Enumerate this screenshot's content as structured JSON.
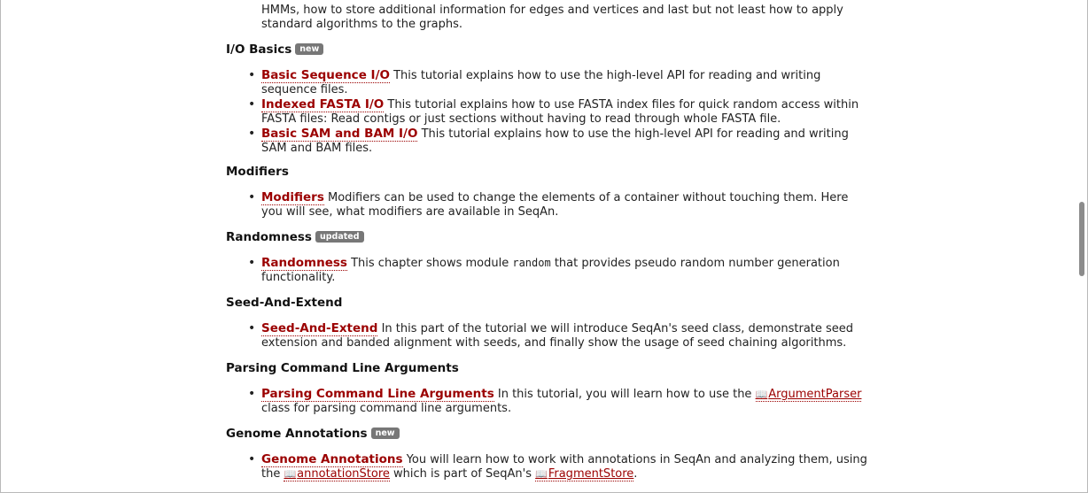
{
  "intro": "HMMs, how to store additional information for edges and vertices and last but not least how to apply standard algorithms to the graphs.",
  "sections": [
    {
      "heading": "I/O Basics",
      "badge": "new",
      "items": [
        {
          "link": "Basic Sequence I/O",
          "text": " This tutorial explains how to use the high-level API for reading and writing sequence files."
        },
        {
          "link": "Indexed FASTA I/O",
          "text": " This tutorial explains how to use FASTA index files for quick random access within FASTA files: Read contigs or just sections without having to read through whole FASTA file."
        },
        {
          "link": "Basic SAM and BAM I/O",
          "text": " This tutorial explains how to use the high-level API for reading and writing SAM and BAM files."
        }
      ]
    },
    {
      "heading": "Modifiers",
      "items": [
        {
          "link": "Modifiers",
          "text": " Modifiers can be used to change the elements of a container without touching them. Here you will see, what modifiers are available in SeqAn."
        }
      ]
    },
    {
      "heading": "Randomness",
      "badge": "updated",
      "items": [
        {
          "link": "Randomness",
          "text_before": " This chapter shows module ",
          "code": "random",
          "text_after": " that provides pseudo random number generation functionality."
        }
      ]
    },
    {
      "heading": "Seed-And-Extend",
      "items": [
        {
          "link": "Seed-And-Extend",
          "text": " In this part of the tutorial we will introduce SeqAn's seed class, demonstrate seed extension and banded alignment with seeds, and finally show the usage of seed chaining algorithms."
        }
      ]
    },
    {
      "heading": "Parsing Command Line Arguments",
      "items": [
        {
          "link": "Parsing Command Line Arguments",
          "text_before": " In this tutorial, you will learn how to use the ",
          "ref1": "ArgumentParser",
          "text_after": " class for parsing command line arguments."
        }
      ]
    },
    {
      "heading": "Genome Annotations",
      "badge": "new",
      "items": [
        {
          "link": "Genome Annotations",
          "text_before": " You will learn how to work with annotations in SeqAn and analyzing them, using the ",
          "ref1": "annotationStore",
          "text_mid": " which is part of SeqAn's ",
          "ref2": "FragmentStore",
          "text_after": "."
        }
      ]
    }
  ],
  "icons": {
    "book": "book-icon"
  }
}
